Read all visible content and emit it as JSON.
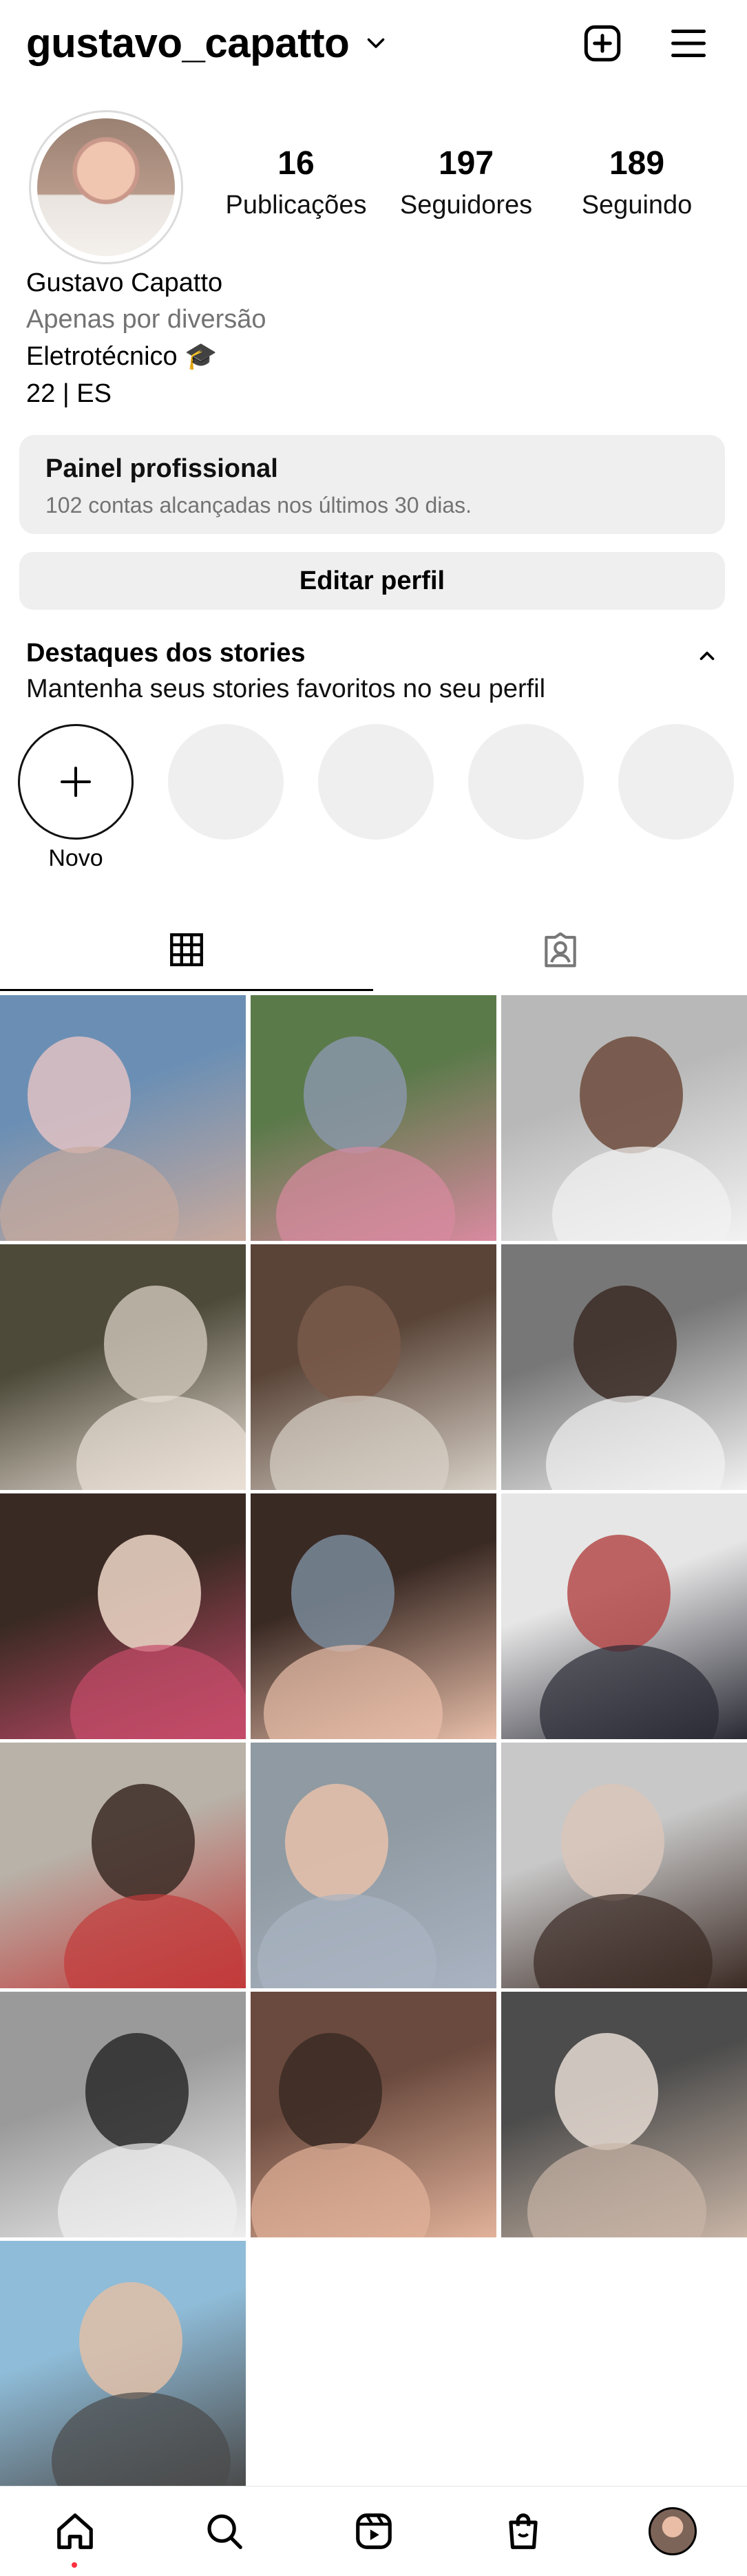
{
  "header": {
    "username": "gustavo_capatto",
    "icons": [
      "chevron-down-icon",
      "add-post-icon",
      "menu-icon"
    ]
  },
  "profile": {
    "stats": [
      {
        "value": "16",
        "label": "Publicações"
      },
      {
        "value": "197",
        "label": "Seguidores"
      },
      {
        "value": "189",
        "label": "Seguindo"
      }
    ],
    "name": "Gustavo Capatto",
    "category": "Apenas por diversão",
    "bio_line1": "Eletrotécnico 🎓",
    "bio_line2": "22  |  ES"
  },
  "professional_panel": {
    "title": "Painel profissional",
    "subtitle": "102 contas alcançadas nos últimos 30 dias."
  },
  "edit_profile_label": "Editar perfil",
  "highlights": {
    "title": "Destaques dos stories",
    "subtitle": "Mantenha seus stories favoritos no seu perfil",
    "new_label": "Novo",
    "placeholders": 4
  },
  "tabs": [
    "grid-icon",
    "tagged-icon"
  ],
  "grid": {
    "count": 16,
    "colors": [
      [
        "#6b8fb4",
        "#c8a99c",
        "#e0c2c4"
      ],
      [
        "#5b7a4a",
        "#d98aa0",
        "#8a97a8"
      ],
      [
        "#b8b8b8",
        "#f2f2f2",
        "#6d4b3c"
      ],
      [
        "#4d4a3a",
        "#eadfd5",
        "#c9c1b4"
      ],
      [
        "#5a4438",
        "#d9d2c8",
        "#7a5a4a"
      ],
      [
        "#777777",
        "#f2f2f2",
        "#3b2a24"
      ],
      [
        "#3a2a24",
        "#c54b6a",
        "#f0d8c9"
      ],
      [
        "#3a2a24",
        "#e9bfaa",
        "#7a8a9a"
      ],
      [
        "#e6e6e6",
        "#2a2a35",
        "#b54a4a"
      ],
      [
        "#b8b2a8",
        "#c23a3a",
        "#3b2a24"
      ],
      [
        "#8f9aa2",
        "#a9b3c2",
        "#e8c1aa"
      ],
      [
        "#c8c8c8",
        "#3b2a24",
        "#d9c6ba"
      ],
      [
        "#9a9a9a",
        "#efefef",
        "#2a2a2a"
      ],
      [
        "#6a4a3e",
        "#e2b29a",
        "#3a2a24"
      ],
      [
        "#4c4c4c",
        "#c9b5a6",
        "#e5dad2"
      ],
      [
        "#8fbcd8",
        "#4a4a4a",
        "#e0c0a8"
      ]
    ]
  },
  "bottom_nav": {
    "icons": [
      "home-icon",
      "search-icon",
      "reels-icon",
      "shop-icon",
      "profile-avatar"
    ]
  }
}
